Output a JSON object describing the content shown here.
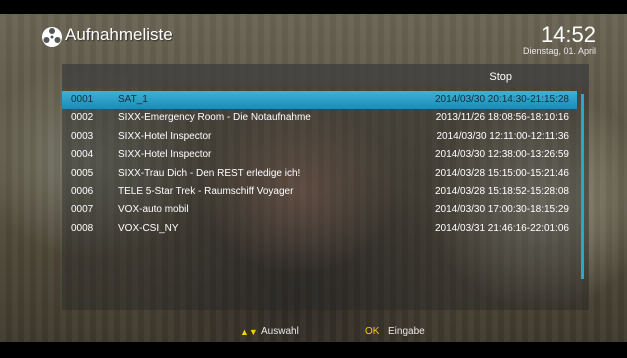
{
  "header": {
    "title": "Aufnahmeliste",
    "clock": "14:52",
    "date": "Dienstag, 01. April"
  },
  "list": {
    "column_stop": "Stop",
    "items": [
      {
        "num": "0001",
        "name": "SAT_1",
        "time": "2014/03/30 20:14:30-21:15:28"
      },
      {
        "num": "0002",
        "name": "SIXX-Emergency Room - Die Notaufnahme",
        "time": "2013/11/26 18:08:56-18:10:16"
      },
      {
        "num": "0003",
        "name": "SIXX-Hotel Inspector",
        "time": "2014/03/30 12:11:00-12:11:36"
      },
      {
        "num": "0004",
        "name": "SIXX-Hotel Inspector",
        "time": "2014/03/30 12:38:00-13:26:59"
      },
      {
        "num": "0005",
        "name": "SIXX-Trau Dich - Den REST erledige ich!",
        "time": "2014/03/28 15:15:00-15:21:46"
      },
      {
        "num": "0006",
        "name": "TELE 5-Star Trek - Raumschiff Voyager",
        "time": "2014/03/28 15:18:52-15:28:08"
      },
      {
        "num": "0007",
        "name": "VOX-auto mobil",
        "time": "2014/03/30 17:00:30-18:15:29"
      },
      {
        "num": "0008",
        "name": "VOX-CSI_NY",
        "time": "2014/03/31 21:46:16-22:01:06"
      }
    ]
  },
  "hints": {
    "arrows": "▲▼",
    "select_label": "Auswahl",
    "ok_key": "OK",
    "enter_label": "Eingabe"
  },
  "colors": {
    "selection": "#2aa6d3",
    "hint_key": "#f4d000"
  }
}
